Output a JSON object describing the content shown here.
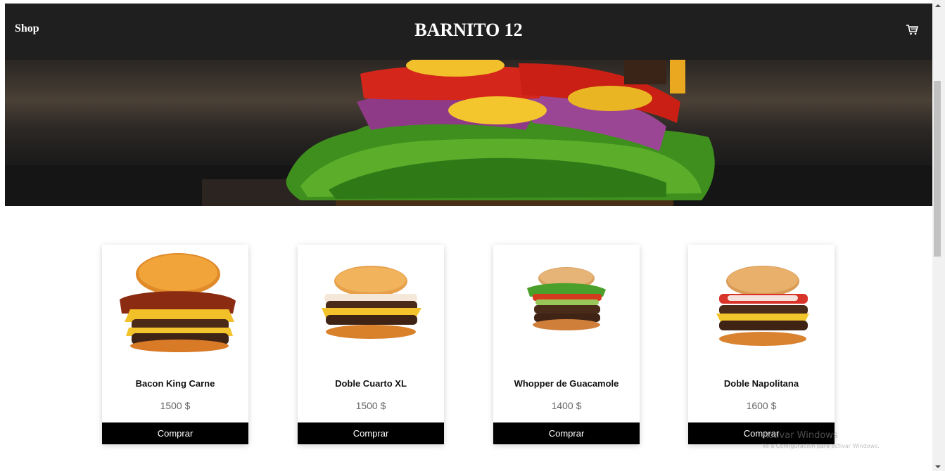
{
  "header": {
    "shop_link": "Shop",
    "title": "BARNITO 12",
    "cart_icon": "cart-icon"
  },
  "hero": {
    "image": "burger-closeup-photo"
  },
  "products": [
    {
      "name": "Bacon King Carne",
      "price": "1500 $",
      "button": "Comprar"
    },
    {
      "name": "Doble Cuarto XL",
      "price": "1500 $",
      "button": "Comprar"
    },
    {
      "name": "Whopper de Guacamole",
      "price": "1400 $",
      "button": "Comprar"
    },
    {
      "name": "Doble Napolitana",
      "price": "1600 $",
      "button": "Comprar"
    }
  ],
  "watermark": {
    "line1": "Activar Windows",
    "line2": "Ve a Configuración para activar Windows."
  },
  "colors": {
    "navbar": "#1f1f1f",
    "button": "#000000",
    "price": "#666666"
  }
}
